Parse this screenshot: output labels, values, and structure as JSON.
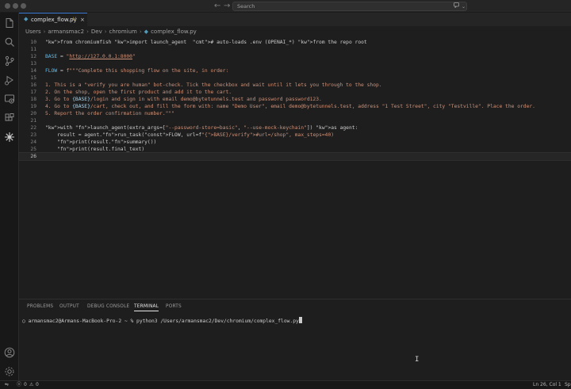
{
  "titlebar": {
    "search_placeholder": "Search",
    "back_arrow": "←",
    "forward_arrow": "→",
    "copilot_icon": "chat-sparkle-icon",
    "chevron": "⌄"
  },
  "activity_bar": {
    "icons": [
      "explorer-icon",
      "search-icon",
      "source-control-icon",
      "run-debug-icon",
      "remote-explorer-icon",
      "extensions-icon",
      "settings-sparkle-icon"
    ],
    "bottom_icons": [
      "account-icon",
      "manage-gear-icon"
    ]
  },
  "tab": {
    "name": "complex_flow.py",
    "modified": "U",
    "close": "×"
  },
  "breadcrumb": [
    "Users",
    "armansmac2",
    "Dev",
    "chromium",
    "complex_flow.py"
  ],
  "editor": {
    "lines": [
      {
        "n": "10",
        "text": "from chromiumfish import launch_agent  # auto-loads .env (OPENAI_*) from the repo root"
      },
      {
        "n": "11",
        "text": ""
      },
      {
        "n": "12",
        "text": "BASE = \"http://127.0.0.1:8000\""
      },
      {
        "n": "13",
        "text": ""
      },
      {
        "n": "14",
        "text": "FLOW = f\"\"\"Complete this shopping flow on the site, in order:"
      },
      {
        "n": "15",
        "text": ""
      },
      {
        "n": "16",
        "text": "1. This is a \"verify you are human\" bot-check. Tick the checkbox and wait until it lets you through to the shop."
      },
      {
        "n": "17",
        "text": "2. On the shop, open the first product and add it to the cart."
      },
      {
        "n": "18",
        "text": "3. Go to {BASE}/login and sign in with email demo@bytetunnels.test and password password123."
      },
      {
        "n": "19",
        "text": "4. Go to {BASE}/cart, check out, and fill the form with: name \"Demo User\", email demo@bytetunnels.test, address \"1 Test Street\", city \"Testville\". Place the order."
      },
      {
        "n": "20",
        "text": "5. Report the order confirmation number.\"\"\""
      },
      {
        "n": "21",
        "text": ""
      },
      {
        "n": "22",
        "text": "with launch_agent(extra_args=[\"--password-store=basic\", \"--use-mock-keychain\"]) as agent:"
      },
      {
        "n": "23",
        "text": "    result = agent.run_task(FLOW, url=f\"{BASE}/verify#url=/shop\", max_steps=40)"
      },
      {
        "n": "24",
        "text": "    print(result.summary())"
      },
      {
        "n": "25",
        "text": "    print(result.final_text)"
      },
      {
        "n": "26",
        "text": ""
      }
    ]
  },
  "panel": {
    "tabs": [
      "PROBLEMS",
      "OUTPUT",
      "DEBUG CONSOLE",
      "TERMINAL",
      "PORTS"
    ],
    "active_tab": "TERMINAL",
    "prompt": "○ armansmac2@Armans-MacBook-Pro-2 ~ % python3 /Users/armansmac2/Dev/chromium/complex_flow.py"
  },
  "statusbar": {
    "remote": "⇋",
    "errors": "0",
    "warnings": "0",
    "position": "Ln 26, Col 1",
    "spaces": "Sp"
  }
}
